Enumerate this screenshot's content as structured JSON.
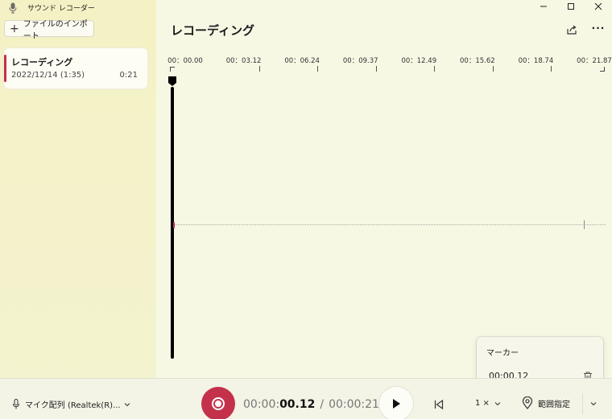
{
  "window": {
    "title": "サウンド レコーダー",
    "controls": [
      "minimize-icon",
      "maximize-icon",
      "close-icon"
    ]
  },
  "sidebar": {
    "import_label": "ファイルのインポート",
    "recordings": [
      {
        "name": "レコーディング",
        "date": "2022/12/14 (1:35)",
        "duration": "0:21"
      }
    ]
  },
  "main": {
    "title": "レコーディング",
    "timeline": {
      "labels": [
        "00：00.00",
        "00：03.12",
        "00：06.24",
        "00：09.37",
        "00：12.49",
        "00：15.62",
        "00：18.74",
        "00：21.87"
      ],
      "playhead_seconds": 0.12,
      "total_seconds": 21.87
    }
  },
  "marker_panel": {
    "title": "マーカー",
    "time": "00:00.12"
  },
  "bottom": {
    "mic_label": "マイク配列 (Realtek(R)...",
    "timer_prefix": "00:00:",
    "timer_current_bold": "00.12",
    "timer_separator": "/",
    "timer_total": "00:00:21",
    "speed_label": "1 ×",
    "range_label": "範囲指定"
  },
  "colors": {
    "accent_red": "#c4314b",
    "sidebar_bg": "#f4f1c4",
    "main_bg": "#f7f8e4"
  }
}
